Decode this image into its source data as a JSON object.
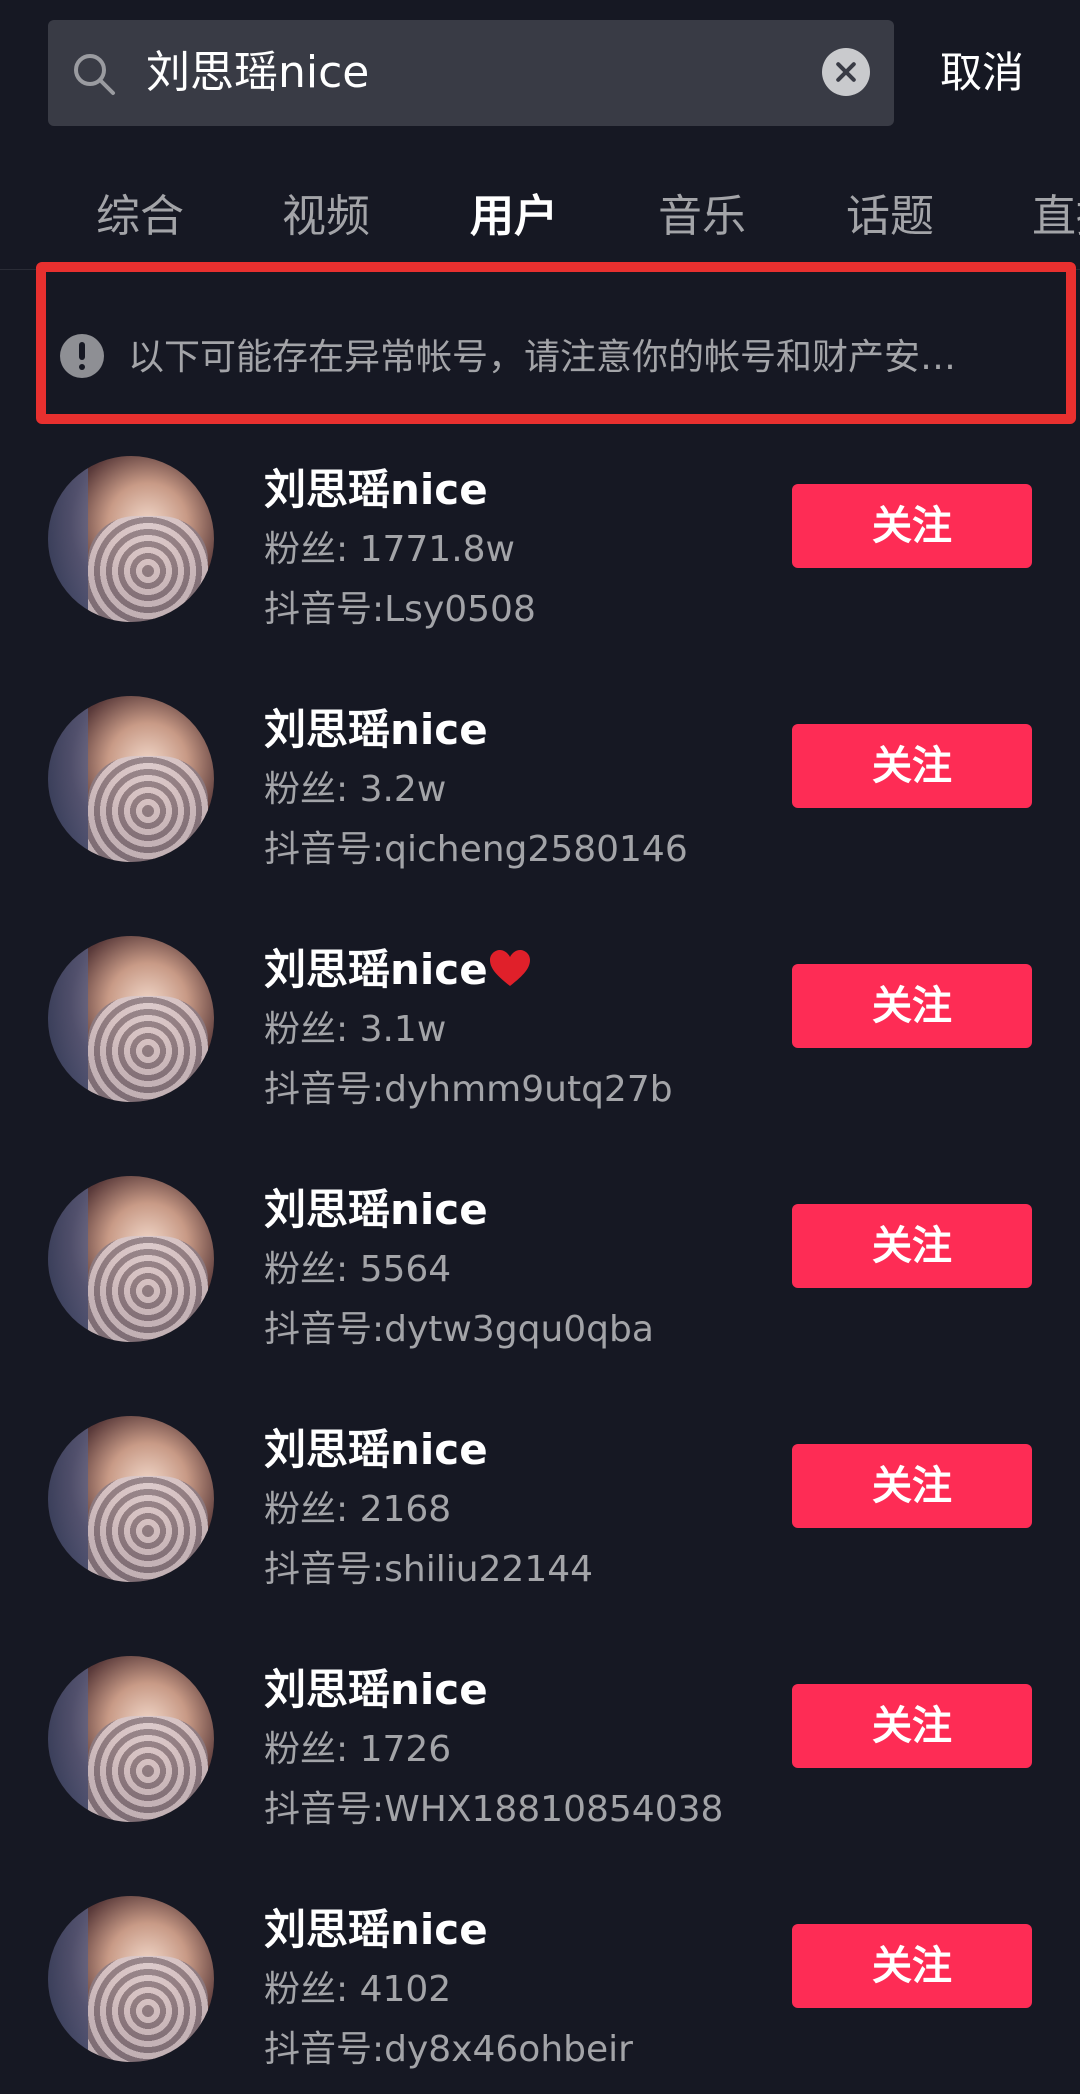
{
  "search": {
    "query": "刘思瑶nice",
    "cancel_label": "取消"
  },
  "tabs": [
    {
      "label": "综合"
    },
    {
      "label": "视频"
    },
    {
      "label": "用户",
      "active": true
    },
    {
      "label": "音乐"
    },
    {
      "label": "话题"
    },
    {
      "label": "直播"
    }
  ],
  "notice": {
    "text": "以下可能存在异常帐号，请注意你的帐号和财产安…"
  },
  "users": [
    {
      "name": "刘思瑶nice",
      "fans": "粉丝: 1771.8w",
      "id": "抖音号:Lsy0508",
      "follow_label": "关注",
      "heart": false
    },
    {
      "name": "刘思瑶nice",
      "fans": "粉丝: 3.2w",
      "id": "抖音号:qicheng2580146",
      "follow_label": "关注",
      "heart": false
    },
    {
      "name": "刘思瑶nice",
      "fans": "粉丝: 3.1w",
      "id": "抖音号:dyhmm9utq27b",
      "follow_label": "关注",
      "heart": true
    },
    {
      "name": "刘思瑶nice",
      "fans": "粉丝: 5564",
      "id": "抖音号:dytw3gqu0qba",
      "follow_label": "关注",
      "heart": false
    },
    {
      "name": "刘思瑶nice",
      "fans": "粉丝: 2168",
      "id": "抖音号:shiliu22144",
      "follow_label": "关注",
      "heart": false
    },
    {
      "name": "刘思瑶nice",
      "fans": "粉丝: 1726",
      "id": "抖音号:WHX18810854038",
      "follow_label": "关注",
      "heart": false
    },
    {
      "name": "刘思瑶nice",
      "fans": "粉丝: 4102",
      "id": "抖音号:dy8x46ohbeir",
      "follow_label": "关注",
      "heart": false
    }
  ],
  "colors": {
    "background": "#161823",
    "accent": "#fe2c55",
    "notice_border": "#e8302f"
  }
}
